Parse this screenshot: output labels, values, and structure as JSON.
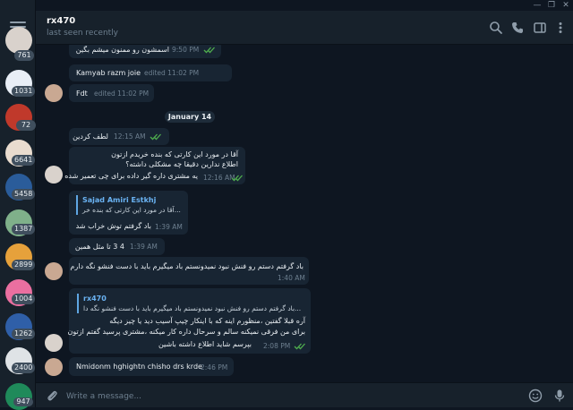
{
  "window": {
    "minimize": "—",
    "restore": "❐",
    "close": "✕"
  },
  "chats": [
    {
      "badge": "761",
      "color": "#d9d2cc"
    },
    {
      "badge": "1031",
      "color": "#e8eef6"
    },
    {
      "badge": "72",
      "color": "#c0392b"
    },
    {
      "badge": "6641",
      "color": "#e9dccf"
    },
    {
      "badge": "5458",
      "color": "#2a5c9a"
    },
    {
      "badge": "1387",
      "color": "#7fb08a"
    },
    {
      "badge": "2899",
      "color": "#e6a13b"
    },
    {
      "badge": "1004",
      "color": "#ea6fa0"
    },
    {
      "badge": "1262",
      "color": "#2f5fa8"
    },
    {
      "badge": "2400",
      "color": "#dfe3e6"
    },
    {
      "badge": "947",
      "color": "#1f8a5a"
    }
  ],
  "header": {
    "title": "rx470",
    "status": "last seen recently"
  },
  "date_separator": "January 14",
  "messages": [
    {
      "id": "m1",
      "text": "اسمشون رو ممنون میشم بگین",
      "time": "9:50 PM",
      "read": true
    },
    {
      "id": "m2",
      "text": "Kamyab razm joie",
      "time": "edited 11:02 PM"
    },
    {
      "id": "m3",
      "text": "Fdt",
      "time": "edited 11:02 PM"
    },
    {
      "id": "m4",
      "text": "لطف کردین",
      "time": "12:15 AM",
      "read": true
    },
    {
      "id": "m5",
      "lines": [
        "آقا در مورد این کارتی که بنده خریدم ازتون",
        "اطلاع ندارین دقیقا چه مشکلی داشته؟",
        "یه مشتری داره گیر داده برای چی تعمیر شده"
      ],
      "time": "12:16 AM",
      "read": true
    },
    {
      "id": "m6",
      "quote_name": "Sajad Amiri Estkhj",
      "quote_text": "...آقا در مورد این کارتی که بنده خر",
      "text": "باد گرفتم توش خراب شد",
      "time": "1:39 AM"
    },
    {
      "id": "m7",
      "text": "4 3 تا مثل همین",
      "time": "1:39 AM"
    },
    {
      "id": "m8",
      "text": "باد گرفتم دستم رو فنش نبود نمیدونستم باد میگیرم باید با دست فنشو نگه دارم",
      "time": "1:40 AM"
    },
    {
      "id": "m9",
      "quote_name": "rx470",
      "quote_text": "...باد گرفتم دستم رو فنش نبود نمیدونستم باد میگیرم باید با دست فنشو نگه دا",
      "lines": [
        "آره قبلا گفتین ،منظورم اینه که با اینکار چیپ آسیب دید یا چیز دیگه",
        "برای من فرقی نمیکنه سالم و سرحال داره کار میکنه ،مشتری پرسید گفتم ازتون",
        "بپرسم شاید اطلاع داشته باشین"
      ],
      "time": "2:08 PM",
      "read": true
    },
    {
      "id": "m10",
      "text": "Nmidonm hghightn chisho drs krde",
      "time": "2:46 PM"
    }
  ],
  "composer": {
    "placeholder": "Write a message..."
  },
  "colors": {
    "accent": "#5fa6e3",
    "check": "#4fae4e",
    "bubble": "#182533",
    "background": "#0e1621"
  },
  "icons": [
    "menu-icon",
    "search-icon",
    "phone-icon",
    "sidebar-icon",
    "more-icon",
    "attach-icon",
    "emoji-icon",
    "mic-icon",
    "double-check-icon"
  ]
}
